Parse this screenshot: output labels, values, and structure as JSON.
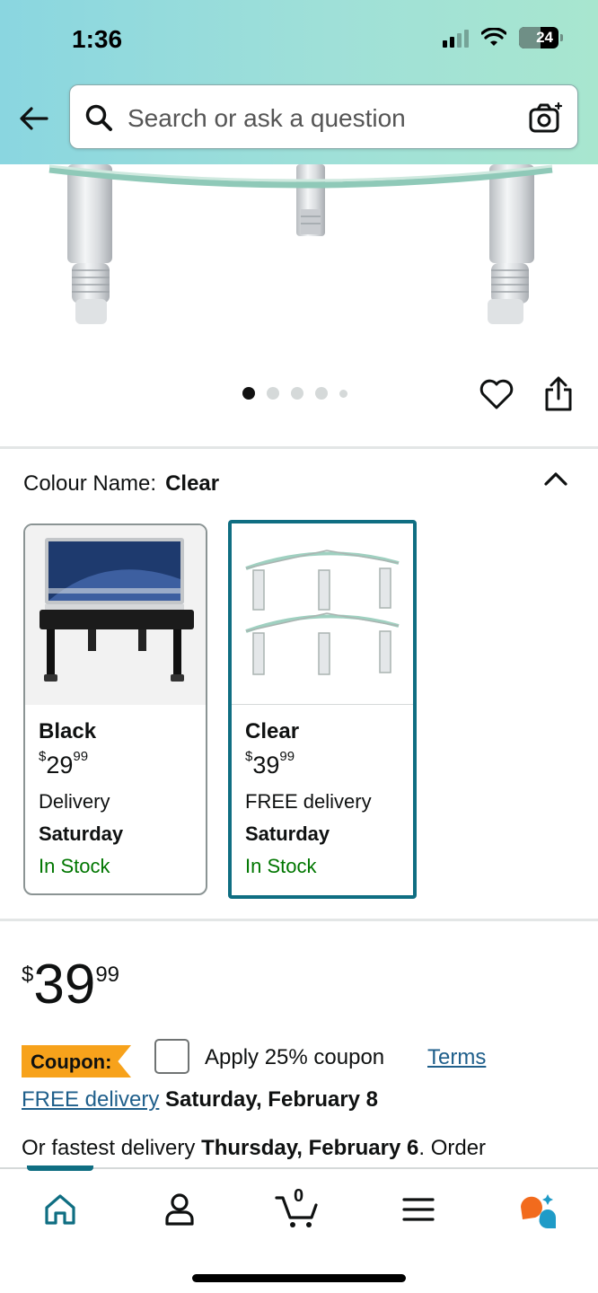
{
  "status_bar": {
    "time": "1:36",
    "battery": "24"
  },
  "search": {
    "placeholder": "Search or ask a question"
  },
  "carousel": {
    "dot_count": 5,
    "active_index": 0
  },
  "colour": {
    "label": "Colour Name:",
    "selected": "Clear"
  },
  "variants": [
    {
      "name": "Black",
      "price_symbol": "$",
      "price_whole": "29",
      "price_fraction": "99",
      "delivery": "Delivery",
      "day": "Saturday",
      "stock": "In Stock"
    },
    {
      "name": "Clear",
      "price_symbol": "$",
      "price_whole": "39",
      "price_fraction": "99",
      "delivery": "FREE delivery",
      "day": "Saturday",
      "stock": "In Stock"
    }
  ],
  "price": {
    "symbol": "$",
    "whole": "39",
    "fraction": "99"
  },
  "coupon": {
    "badge": "Coupon:",
    "text": "Apply 25% coupon",
    "terms": "Terms"
  },
  "delivery": {
    "link": "FREE delivery",
    "date": "Saturday, February 8"
  },
  "fastest": {
    "prefix": "Or fastest delivery ",
    "date": "Thursday, February 6",
    "suffix": ". Order"
  },
  "nav": {
    "items": [
      "home-icon",
      "account-icon",
      "cart-icon",
      "menu-icon",
      "rufus-icon"
    ],
    "cart_count": "0"
  },
  "colors": {
    "accent": "#0f6e82",
    "link": "#1f5f8b",
    "in_stock": "#007600",
    "coupon": "#f7a21b"
  }
}
